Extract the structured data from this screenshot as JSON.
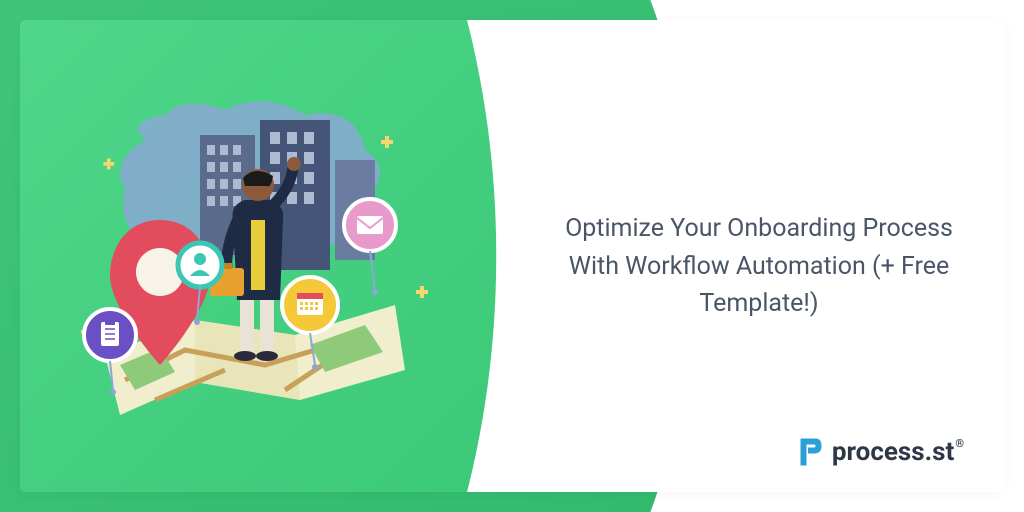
{
  "headline": "Optimize Your Onboarding Process With Workflow Automation (+ Free Template!)",
  "brand": {
    "name": "process.st",
    "registered_mark": "®"
  },
  "colors": {
    "green_primary": "#3fc47a",
    "green_light": "#4fd68a",
    "text": "#4a5568"
  }
}
